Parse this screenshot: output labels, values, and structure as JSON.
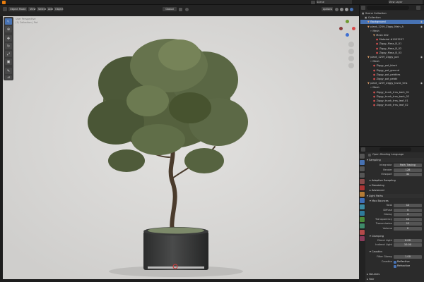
{
  "topbar": {
    "scene_label": "Scene",
    "view_layer_label": "View Layer"
  },
  "viewport_header": {
    "mode_label": "Object Mode",
    "menus": [
      "View",
      "Select",
      "Add",
      "Object"
    ],
    "transform_orientation": "Global",
    "overlay_label": "options"
  },
  "viewport": {
    "info_lines": [
      "User Perspective",
      "(1) Collection | Pot"
    ],
    "axes": [
      "X",
      "Y",
      "Z"
    ]
  },
  "outliner": {
    "rows": [
      {
        "text": "Scene Collection",
        "level": 0,
        "kind": "collection"
      },
      {
        "text": "Collection",
        "level": 1,
        "kind": "collection"
      },
      {
        "text": "Background",
        "level": 2,
        "kind": "mesh",
        "selected": true
      },
      {
        "text": "plant_1259_Ziggy_Main_A",
        "level": 2,
        "kind": "mesh"
      },
      {
        "text": "Mesh",
        "level": 3,
        "kind": "group"
      },
      {
        "text": "Mesh 002",
        "level": 4,
        "kind": "mesh"
      },
      {
        "text": "Material #1053257",
        "level": 5,
        "kind": "mat"
      },
      {
        "text": "Ziggy_Mass_B_01",
        "level": 5,
        "kind": "mat"
      },
      {
        "text": "Ziggy_Mass_B_02",
        "level": 5,
        "kind": "mat"
      },
      {
        "text": "Ziggy_Mass_B_03",
        "level": 5,
        "kind": "mat"
      },
      {
        "text": "plant_1259_Ziggy_pot",
        "level": 2,
        "kind": "mesh"
      },
      {
        "text": "Mesh",
        "level": 3,
        "kind": "group"
      },
      {
        "text": "Ziggy_pot_black",
        "level": 4,
        "kind": "mat"
      },
      {
        "text": "Ziggy_pot_ground",
        "level": 4,
        "kind": "mat"
      },
      {
        "text": "Ziggy_pot_pebbles",
        "level": 4,
        "kind": "mat"
      },
      {
        "text": "Ziggy_pot_pebbl",
        "level": 4,
        "kind": "mat"
      },
      {
        "text": "plant_1259_Ziggy_trunk_trns",
        "level": 2,
        "kind": "mesh"
      },
      {
        "text": "Mesh",
        "level": 3,
        "kind": "group"
      },
      {
        "text": "Ziggy_trunk_trns_bark_01",
        "level": 4,
        "kind": "mat"
      },
      {
        "text": "Ziggy_trunk_trns_bark_02",
        "level": 4,
        "kind": "mat"
      },
      {
        "text": "Ziggy_trunk_trns_leaf_01",
        "level": 4,
        "kind": "mat"
      },
      {
        "text": "Ziggy_trunk_trns_leaf_02",
        "level": 4,
        "kind": "mat"
      }
    ]
  },
  "properties": {
    "search_placeholder": "",
    "shading_language": "Open Shading Language",
    "sampling_header": "Sampling",
    "integrator_label": "Integrator",
    "integrator_value": "Path Tracing",
    "render_label": "Render",
    "render_value": "128",
    "viewport_label": "Viewport",
    "viewport_value": "32",
    "adaptive_label": "Adaptive Sampling",
    "denoising_label": "Denoising",
    "advanced_label": "Advanced",
    "light_paths_header": "Light Paths",
    "max_bounces_header": "Max Bounces",
    "bounces": [
      {
        "label": "Total",
        "value": "12"
      },
      {
        "label": "Diffuse",
        "value": "4"
      },
      {
        "label": "Glossy",
        "value": "4"
      },
      {
        "label": "Transparency",
        "value": "12"
      },
      {
        "label": "Transmission",
        "value": "12"
      },
      {
        "label": "Volume",
        "value": "0"
      }
    ],
    "clamping_header": "Clamping",
    "direct_light_label": "Direct Light",
    "direct_light_value": "0.00",
    "indirect_light_label": "Indirect Light",
    "indirect_light_value": "10.00",
    "caustics_header": "Caustics",
    "filter_glossy_label": "Filter Glossy",
    "filter_glossy_value": "1.00",
    "caustics_label": "Caustics",
    "reflective_label": "Reflective",
    "refractive_label": "Refractive",
    "volumes_header": "Volumes",
    "hair_header": "Hair"
  }
}
